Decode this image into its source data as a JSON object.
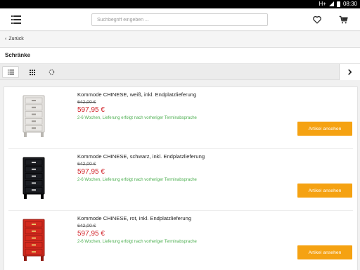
{
  "status": {
    "network": "H+",
    "time": "08:30"
  },
  "header": {
    "search_placeholder": "Suchbegriff eingeben ..."
  },
  "nav": {
    "back_label": "Zurück"
  },
  "page": {
    "title": "Schränke"
  },
  "products": [
    {
      "name": "Kommode CHINESE, weiß, inkl. Endplatzlieferung",
      "old_price": "642,00 €",
      "price": "597,95 €",
      "delivery": "2-6 Wochen, Lieferung erfolgt nach vorheriger Terminabsprache",
      "button": "Artikel ansehen",
      "color": "#e8e6e3"
    },
    {
      "name": "Kommode CHINESE, schwarz, inkl. Endplatzlieferung",
      "old_price": "642,00 €",
      "price": "597,95 €",
      "delivery": "2-6 Wochen, Lieferung erfolgt nach vorheriger Terminabsprache",
      "button": "Artikel ansehen",
      "color": "#1b1d22"
    },
    {
      "name": "Kommode CHINESE, rot, inkl. Endplatzlieferung",
      "old_price": "642,00 €",
      "price": "597,95 €",
      "delivery": "2-6 Wochen, Lieferung erfolgt nach vorheriger Terminabsprache",
      "button": "Artikel ansehen",
      "color": "#d42a1e"
    }
  ],
  "colors": {
    "accent": "#f5a212",
    "price": "#d2232a",
    "delivery": "#4caf50"
  },
  "icons": [
    "menu-icon",
    "heart-icon",
    "cart-icon",
    "back-chevron-icon",
    "list-view-icon",
    "grid-view-icon",
    "refresh-icon",
    "next-chevron-icon",
    "signal-icon",
    "battery-icon"
  ]
}
